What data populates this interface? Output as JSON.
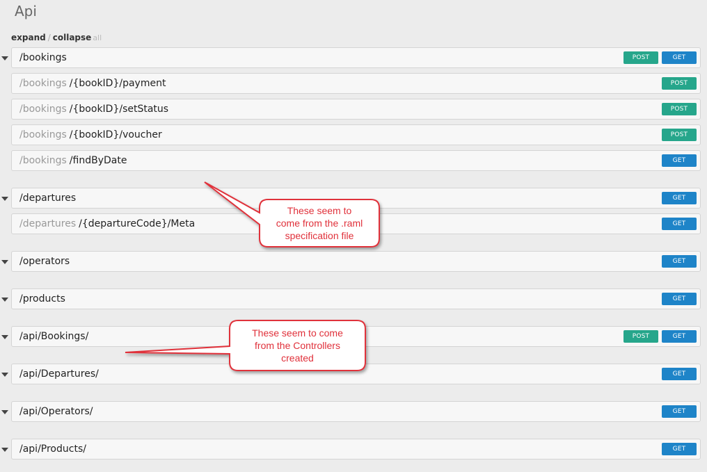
{
  "title": "Api",
  "controls": {
    "expand": "expand",
    "separator": "/",
    "collapse": "collapse",
    "all": "all"
  },
  "method_labels": {
    "post": "POST",
    "get": "GET"
  },
  "resources": [
    {
      "path": "/bookings",
      "methods": [
        "POST",
        "GET"
      ],
      "toggle": true
    },
    {
      "parent": "/bookings",
      "path": "/{bookID}/payment",
      "methods": [
        "POST"
      ]
    },
    {
      "parent": "/bookings",
      "path": "/{bookID}/setStatus",
      "methods": [
        "POST"
      ]
    },
    {
      "parent": "/bookings",
      "path": "/{bookID}/voucher",
      "methods": [
        "POST"
      ]
    },
    {
      "parent": "/bookings",
      "path": "/findByDate",
      "methods": [
        "GET"
      ]
    },
    {
      "path": "/departures",
      "methods": [
        "GET"
      ],
      "toggle": true
    },
    {
      "parent": "/departures",
      "path": "/{departureCode}/Meta",
      "methods": [
        "GET"
      ]
    },
    {
      "path": "/operators",
      "methods": [
        "GET"
      ],
      "toggle": true
    },
    {
      "path": "/products",
      "methods": [
        "GET"
      ],
      "toggle": true
    },
    {
      "path": "/api/Bookings/",
      "methods": [
        "POST",
        "GET"
      ],
      "toggle": true
    },
    {
      "path": "/api/Departures/",
      "methods": [
        "GET"
      ],
      "toggle": true
    },
    {
      "path": "/api/Operators/",
      "methods": [
        "GET"
      ],
      "toggle": true
    },
    {
      "path": "/api/Products/",
      "methods": [
        "GET"
      ],
      "toggle": true
    }
  ],
  "callouts": [
    {
      "lines": [
        "These seem to",
        "come from the .raml",
        "specification file"
      ]
    },
    {
      "lines": [
        "These seem to come",
        "from the Controllers",
        "created"
      ]
    }
  ],
  "colors": {
    "post": "#26a68b",
    "get": "#1e84c8",
    "callout_border": "#e0303a"
  }
}
